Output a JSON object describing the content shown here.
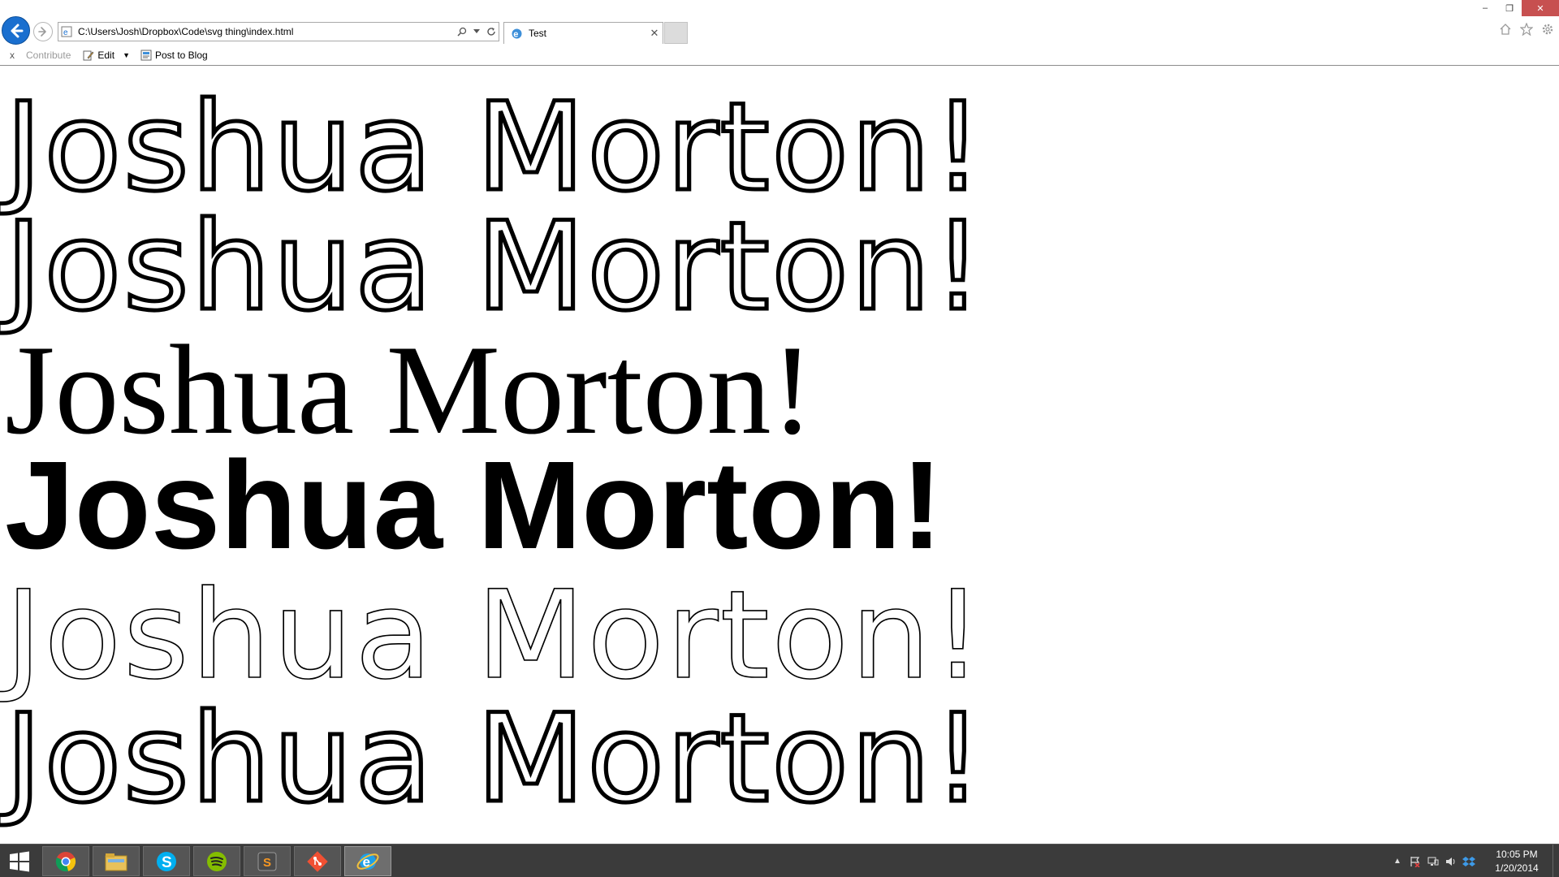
{
  "window": {
    "minimize_glyph": "–",
    "restore_glyph": "❐",
    "close_glyph": "✕"
  },
  "address_bar": {
    "url": "C:\\Users\\Josh\\Dropbox\\Code\\svg thing\\index.html"
  },
  "tab": {
    "title": "Test"
  },
  "command_bar": {
    "close_glyph": "x",
    "contribute_label": "Contribute",
    "edit_label": "Edit",
    "post_label": "Post to Blog"
  },
  "content": {
    "lines": [
      "Joshua Morton!",
      "Joshua Morton!",
      "Joshua Morton!",
      "Joshua Morton!",
      "Joshua Morton!",
      "Joshua Morton!"
    ]
  },
  "taskbar": {
    "apps": [
      "chrome-icon",
      "file-explorer-icon",
      "skype-icon",
      "spotify-icon",
      "sublime-text-icon",
      "git-icon",
      "internet-explorer-icon"
    ],
    "clock_time": "10:05 PM",
    "clock_date": "1/20/2014"
  },
  "colors": {
    "back_button": "#1a6fcf",
    "taskbar_bg": "#3b3b3b",
    "close_button": "#c75050"
  }
}
